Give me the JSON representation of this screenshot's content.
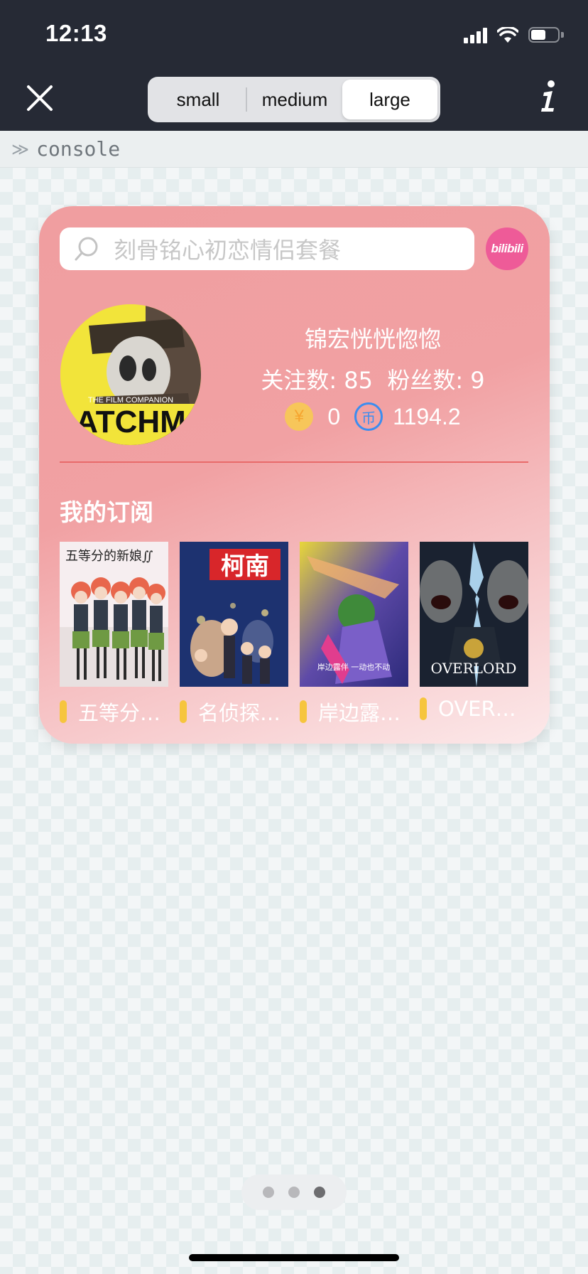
{
  "status_bar": {
    "time": "12:13"
  },
  "top_bar": {
    "segments": [
      {
        "label": "small",
        "active": false
      },
      {
        "label": "medium",
        "active": false
      },
      {
        "label": "large",
        "active": true
      }
    ]
  },
  "console": {
    "label": "console"
  },
  "widget": {
    "search_placeholder": "刻骨铭心初恋情侣套餐",
    "logo_text": "bilibili",
    "user": {
      "name": "锦宏恍恍惚惚",
      "stats": "关注数: 85  粉丝数: 9",
      "coins": "0",
      "bcoins": "1194.2"
    },
    "subscription_title": "我的订阅",
    "subscriptions": [
      {
        "title": "五等分…",
        "cover_text": "五等分的新娘∬"
      },
      {
        "title": "名侦探…",
        "cover_text": "柯南"
      },
      {
        "title": "岸边露…",
        "cover_text": "岸边露伴 一动也不动"
      },
      {
        "title": "OVERL…",
        "cover_text": "OVERLORD"
      }
    ]
  },
  "pager": {
    "count": 3,
    "active_index": 2
  }
}
